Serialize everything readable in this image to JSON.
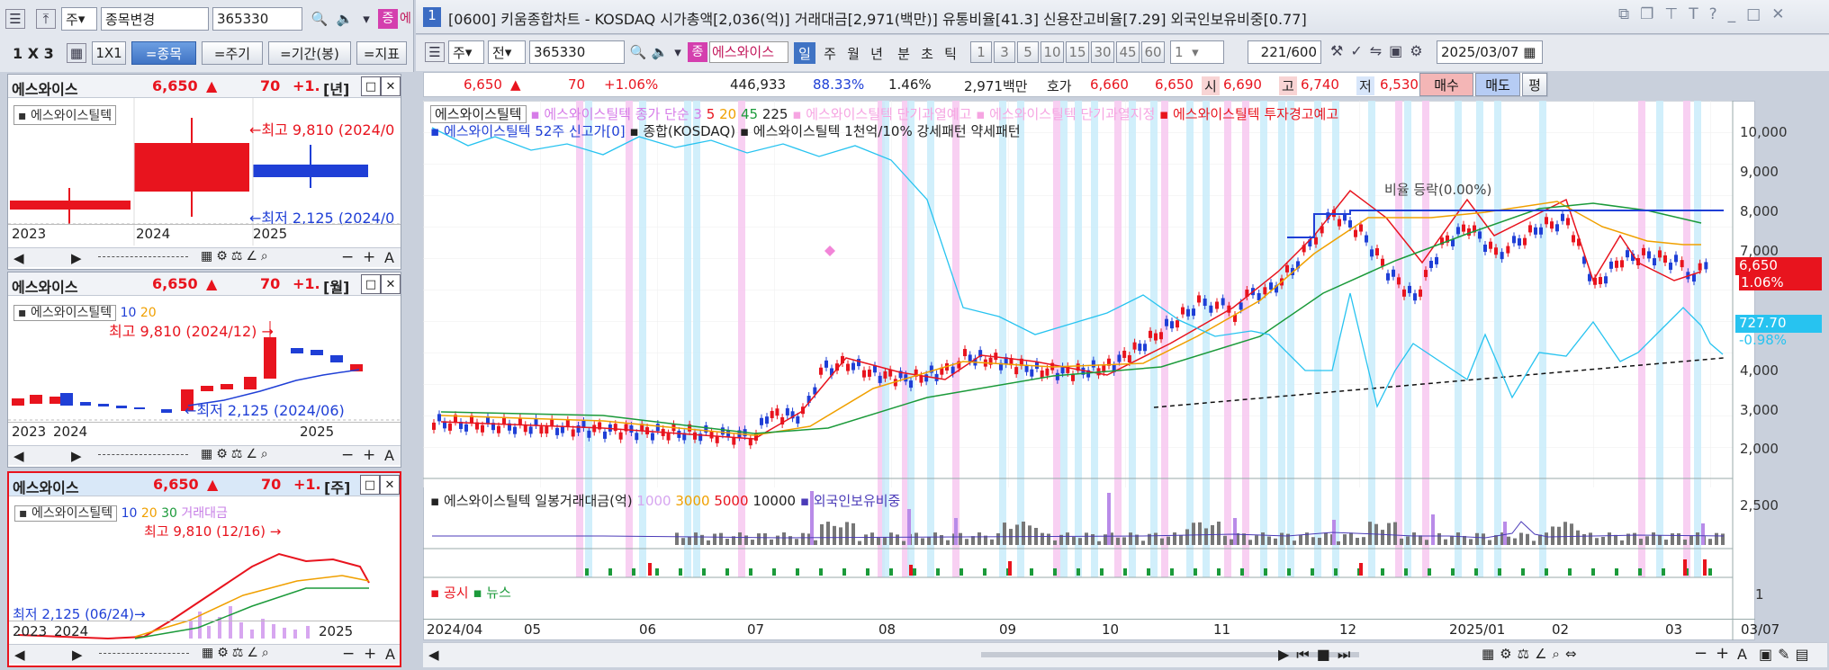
{
  "left_toolbar": {
    "code": "365330",
    "type_label": "주",
    "stock_select": "종목변경",
    "view_btn": "1 X 3",
    "one_by_one": "1X1",
    "by_stock": "=종목",
    "by_period": "=주기",
    "by_range": "=기간(봉)",
    "by_indicator": "=지표",
    "tag": "증",
    "tag2": "에"
  },
  "panels": [
    {
      "name": "에스와이스",
      "price": "6,650",
      "change": "70",
      "pct": "+1.",
      "period": "[년]",
      "legend_name": "에스와이스틸텍",
      "high_note": "최고 9,810 (2024/0",
      "low_note": "최저 2,125 (2024/0",
      "years": [
        "2023",
        "2024",
        "2025"
      ]
    },
    {
      "name": "에스와이스",
      "price": "6,650",
      "change": "70",
      "pct": "+1.",
      "period": "[월]",
      "legend_name": "에스와이스틸텍",
      "ma": [
        "10",
        "20"
      ],
      "high_note": "최고 9,810 (2024/12)",
      "low_note": "최저 2,125 (2024/06)",
      "years": [
        "2023",
        "2024",
        "2025"
      ]
    },
    {
      "name": "에스와이스",
      "price": "6,650",
      "change": "70",
      "pct": "+1.",
      "period": "[주]",
      "legend_name": "에스와이스틸텍",
      "ma": [
        "10",
        "20",
        "30"
      ],
      "extra": "거래대금",
      "high_note": "최고 9,810 (12/16)",
      "low_note": "최저 2,125 (06/24)",
      "years": [
        "2023",
        "2024",
        "2025"
      ]
    }
  ],
  "title": "[0600] 키움종합차트 - KOSDAQ 시가총액[2,036(억)] 거래대금[2,971(백만)] 유통비율[41.3] 신용잔고비율[7.29] 외국인보유비중[0.77]",
  "window_num": "1",
  "toolbar": {
    "type": "주",
    "jeon": "전",
    "code": "365330",
    "tag": "종",
    "name": "에스와이스",
    "periods": [
      "일",
      "주",
      "월",
      "년",
      "분",
      "초",
      "틱"
    ],
    "numbers": [
      "1",
      "3",
      "5",
      "10",
      "15",
      "30",
      "45",
      "60"
    ],
    "count_sel": "1",
    "bars": "221",
    "bars_total": "/600",
    "date": "2025/03/07"
  },
  "quote": {
    "price": "6,650",
    "change": "70",
    "pct": "+1.06%",
    "volume": "446,933",
    "ratio1": "88.33%",
    "ratio2": "1.46%",
    "amount": "2,971백만",
    "hoga_label": "호가",
    "ask": "6,660",
    "bid": "6,650",
    "open_label": "시",
    "open": "6,690",
    "high_label": "고",
    "high": "6,740",
    "low_label": "저",
    "low": "6,530",
    "buy": "매수",
    "sell": "매도",
    "flat": "평"
  },
  "legend_line1": [
    "에스와이스틸텍",
    "에스와이스틸텍 종가 단순 3",
    "5",
    "20",
    "45",
    "225",
    "에스와이스틸텍 단기과열예고",
    "에스와이스틸텍 단기과열지정",
    "에스와이스틸텍 투자경고예고"
  ],
  "legend_line2": [
    "에스와이스틸텍 52주 신고가[0]",
    "종합(KOSDAQ)",
    "에스와이스틸텍 1천억/10% 강세패턴",
    "약세패턴"
  ],
  "y_ticks": [
    "10,000",
    "9,000",
    "8,000",
    "7,000",
    "4,000",
    "3,000",
    "2,000"
  ],
  "price_tag": "6,650",
  "pct_tag": "1.06%",
  "kosdaq_tag": "727.70",
  "kosdaq_pct": "-0.98%",
  "annotation": "비율 등락(0.00%)",
  "sub_legend": [
    "에스와이스틸텍 일봉거래대금(억)",
    "1000",
    "3000",
    "5000",
    "10000",
    "외국인보유비중"
  ],
  "sub_tick": "2,500",
  "news_legend": [
    "공시",
    "뉴스"
  ],
  "news_tick": "1",
  "x_ticks": [
    "2024/04",
    "05",
    "06",
    "07",
    "08",
    "09",
    "10",
    "11",
    "12",
    "2025/01",
    "02",
    "03"
  ],
  "x_end": "03/07",
  "colors": {
    "up": "#e8141e",
    "down": "#1f3fd6",
    "pink": "#f7c8f0",
    "cyan": "#c9ecfa",
    "kosdaq": "#27c3f0"
  }
}
